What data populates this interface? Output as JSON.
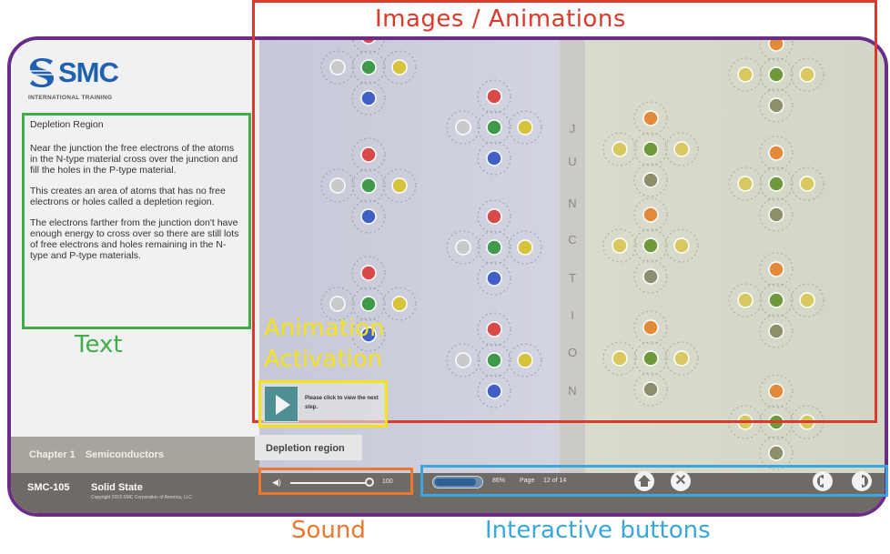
{
  "callouts": {
    "images": "Images / Animations",
    "text": "Text",
    "animation": [
      "Animation",
      "Activation"
    ],
    "sound": "Sound",
    "interactive": "Interactive buttons"
  },
  "logo": {
    "text": "SMC",
    "subtitle": "INTERNATIONAL TRAINING"
  },
  "content": {
    "heading": "Depletion Region",
    "paragraphs": [
      "Near the junction the free electrons of the atoms in the N-type material cross over the junction and fill the holes in the P-type material.",
      "This creates an area of atoms that has no free electrons or holes called a depletion region.",
      "The electrons farther from the junction don't have enough energy to cross over so there are still lots of free electrons and holes remaining in the N-type and P-type materials."
    ]
  },
  "chapter": {
    "label": "Chapter 1",
    "name": "Semiconductors"
  },
  "course": {
    "code": "SMC-105",
    "title": "Solid State",
    "copyright": "Copyright 2013 SMC Corporation of America, LLC"
  },
  "junction_letters": [
    "J",
    "U",
    "N",
    "C",
    "T",
    "I",
    "O",
    "N"
  ],
  "animation": {
    "prompt": "Please click to view the next step.",
    "tab": "Depletion region"
  },
  "sound": {
    "level": 100,
    "level_text": "100"
  },
  "navigation": {
    "progress_pct": 86,
    "progress_text": "86%",
    "page_label": "Page",
    "page_value": "12 of 14"
  },
  "colors": {
    "frame": "#6a2c86",
    "images_callout": "#d93a2b",
    "text_callout": "#3fae49",
    "animation_callout": "#f3e21c",
    "sound_callout": "#ec7730",
    "buttons_callout": "#3aa6dd"
  },
  "icons": [
    "speaker-icon",
    "home-icon",
    "close-icon",
    "previous-icon",
    "next-icon",
    "play-icon"
  ]
}
